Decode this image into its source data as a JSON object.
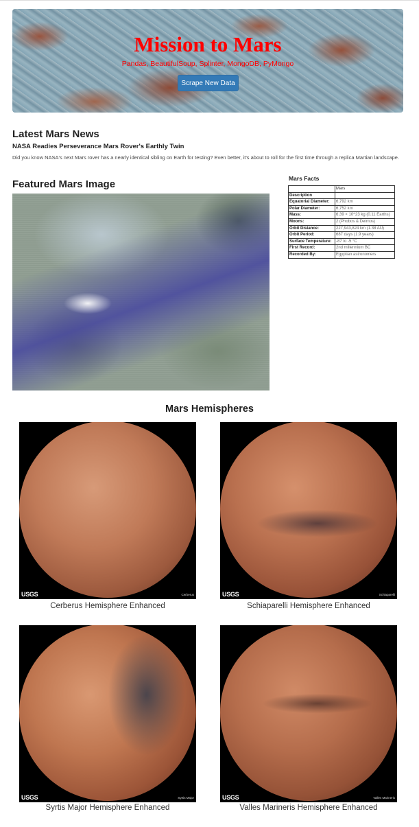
{
  "header": {
    "title": "Mission to Mars",
    "subtitle": "Pandas, BeautifulSoup, Splinter, MongoDB, PyMongo",
    "scrape_button": "Scrape New Data"
  },
  "news": {
    "heading": "Latest Mars News",
    "title": "NASA Readies Perseverance Mars Rover's Earthly Twin",
    "paragraph": "Did you know NASA's next Mars rover has a nearly identical sibling on Earth for testing? Even better, it's about to roll for the first time through a replica Martian landscape."
  },
  "featured": {
    "heading": "Featured Mars Image"
  },
  "facts": {
    "heading": "Mars Facts",
    "column_header": "Mars",
    "description_label": "Description",
    "rows": [
      {
        "key": "Equatorial Diameter:",
        "value": "6,792 km"
      },
      {
        "key": "Polar Diameter:",
        "value": "6,752 km"
      },
      {
        "key": "Mass:",
        "value": "6.39 × 10^23 kg (0.11 Earths)"
      },
      {
        "key": "Moons:",
        "value": "2 (Phobos & Deimos)"
      },
      {
        "key": "Orbit Distance:",
        "value": "227,943,824 km (1.38 AU)"
      },
      {
        "key": "Orbit Period:",
        "value": "687 days (1.9 years)"
      },
      {
        "key": "Surface Temperature:",
        "value": "-87 to -5 °C"
      },
      {
        "key": "First Record:",
        "value": "2nd millennium BC"
      },
      {
        "key": "Recorded By:",
        "value": "Egyptian astronomers"
      }
    ]
  },
  "hemispheres": {
    "heading": "Mars Hemispheres",
    "logo_text": "USGS",
    "items": [
      {
        "caption": "Cerberus Hemisphere Enhanced",
        "tag": "Cerberus"
      },
      {
        "caption": "Schiaparelli Hemisphere Enhanced",
        "tag": "Schiaparelli"
      },
      {
        "caption": "Syrtis Major Hemisphere Enhanced",
        "tag": "Syrtis Major"
      },
      {
        "caption": "Valles Marineris Hemisphere Enhanced",
        "tag": "Valles Marineris"
      }
    ]
  }
}
